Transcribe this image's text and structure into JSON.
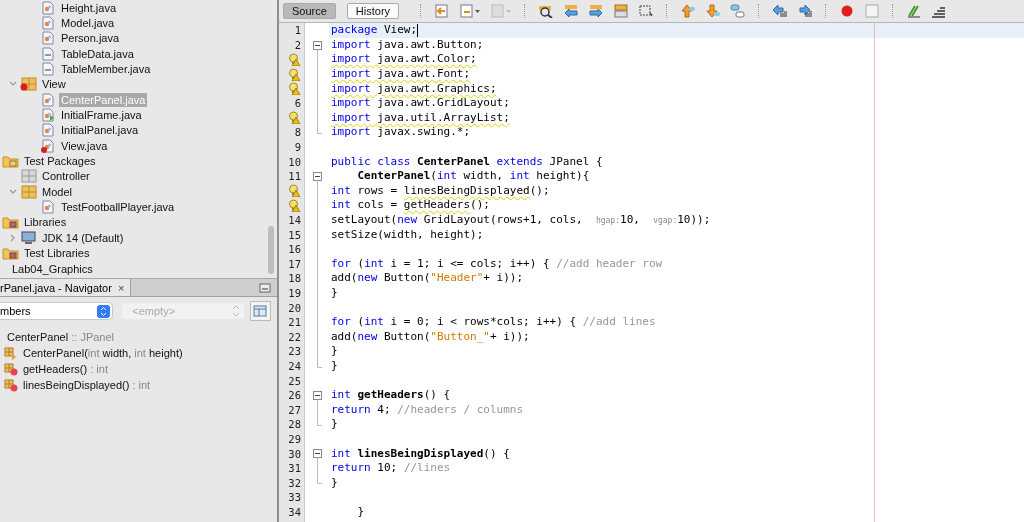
{
  "project_tree": [
    {
      "children": [
        {
          "children": [
            {
              "kind": "class",
              "label": "Height.java",
              "selected": false
            },
            {
              "kind": "class",
              "label": "Model.java",
              "selected": false
            },
            {
              "kind": "class",
              "label": "Person.java",
              "selected": false
            },
            {
              "kind": "interface",
              "label": "TableData.java",
              "selected": false
            },
            {
              "kind": "interface",
              "label": "TableMember.java",
              "selected": false
            }
          ]
        },
        {
          "kind": "package_error",
          "label": "View",
          "expanded": true,
          "selected": false,
          "children": [
            {
              "kind": "class",
              "label": "CenterPanel.java",
              "selected": true
            },
            {
              "kind": "main_class",
              "label": "InitialFrame.java",
              "selected": false
            },
            {
              "kind": "class",
              "label": "InitialPanel.java",
              "selected": false
            },
            {
              "kind": "class_error",
              "label": "View.java",
              "selected": false
            }
          ]
        }
      ]
    },
    {
      "kind": "test_folder",
      "label": "Test Packages",
      "selected": false,
      "children": [
        {
          "kind": "package_empty",
          "label": "Controller",
          "selected": false
        },
        {
          "kind": "package",
          "label": "Model",
          "expanded": true,
          "selected": false,
          "children": [
            {
              "kind": "class",
              "label": "TestFootballPlayer.java",
              "selected": false
            }
          ]
        }
      ]
    },
    {
      "kind": "library_folder",
      "label": "Libraries",
      "selected": false,
      "children": [
        {
          "kind": "jdk",
          "label": "JDK 14 (Default)",
          "expanded": false,
          "selected": false
        }
      ]
    },
    {
      "kind": "library_folder",
      "label": "Test Libraries",
      "selected": false
    },
    {
      "kind": "project",
      "label": "Lab04_Graphics",
      "selected": false
    }
  ],
  "navigator": {
    "title": "rPanel.java - Navigator",
    "close": "×",
    "filter": "mbers",
    "secondary": "<empty>",
    "header": [
      {
        "text": "CenterPanel",
        "muted": false
      },
      {
        "text": " :: JPanel",
        "muted": true
      }
    ],
    "items": [
      {
        "kind": "constructor",
        "parts": [
          {
            "text": "CenterPanel(",
            "muted": false
          },
          {
            "text": "int",
            "muted": true
          },
          {
            "text": " width, ",
            "muted": false
          },
          {
            "text": "int",
            "muted": true
          },
          {
            "text": " height)",
            "muted": false
          }
        ]
      },
      {
        "kind": "method",
        "parts": [
          {
            "text": "getHeaders()",
            "muted": false
          },
          {
            "text": " : int",
            "muted": true
          }
        ]
      },
      {
        "kind": "method",
        "parts": [
          {
            "text": "linesBeingDisplayed()",
            "muted": false
          },
          {
            "text": " : int",
            "muted": true
          }
        ]
      }
    ]
  },
  "editor_tabs": [
    {
      "label": "Source",
      "selected": true
    },
    {
      "label": "History",
      "selected": false
    }
  ],
  "code": [
    {
      "number": "1",
      "warning": false,
      "kind": "plain",
      "current": true,
      "caret": true,
      "tokens": [
        {
          "kind": "keyword",
          "text": "package"
        },
        {
          "kind": "plain",
          "text": " View;"
        }
      ]
    },
    {
      "number": "2",
      "warning": false,
      "kind": "fold_start",
      "tokens": [
        {
          "kind": "keyword",
          "text": "import"
        },
        {
          "kind": "plain",
          "text": " java.awt.Button;"
        }
      ]
    },
    {
      "warning": true,
      "kind": "fold_body",
      "tokens": [
        {
          "kind": "keyword",
          "text": "import",
          "flagged": true
        },
        {
          "kind": "plain",
          "text": " java.awt.Color;",
          "flagged": true
        }
      ]
    },
    {
      "warning": true,
      "kind": "fold_body",
      "tokens": [
        {
          "kind": "keyword",
          "text": "import",
          "flagged": true
        },
        {
          "kind": "plain",
          "text": " java.awt.Font;",
          "flagged": true
        }
      ]
    },
    {
      "warning": true,
      "kind": "fold_body",
      "tokens": [
        {
          "kind": "keyword",
          "text": "import",
          "flagged": true
        },
        {
          "kind": "plain",
          "text": " java.awt.Graphics;",
          "flagged": true
        }
      ]
    },
    {
      "number": "6",
      "warning": false,
      "kind": "fold_body",
      "tokens": [
        {
          "kind": "keyword",
          "text": "import"
        },
        {
          "kind": "plain",
          "text": " java.awt.GridLayout;"
        }
      ]
    },
    {
      "warning": true,
      "kind": "fold_body",
      "tokens": [
        {
          "kind": "keyword",
          "text": "import",
          "flagged": true
        },
        {
          "kind": "plain",
          "text": " java.util.ArrayList;",
          "flagged": true
        }
      ]
    },
    {
      "number": "8",
      "warning": false,
      "kind": "fold_end",
      "tokens": [
        {
          "kind": "keyword",
          "text": "import"
        },
        {
          "kind": "plain",
          "text": " javax.swing.*;"
        }
      ]
    },
    {
      "number": "9",
      "warning": false,
      "kind": "plain"
    },
    {
      "number": "10",
      "warning": false,
      "kind": "plain",
      "tokens": [
        {
          "kind": "keyword",
          "text": "public class"
        },
        {
          "kind": "name",
          "text": " CenterPanel"
        },
        {
          "kind": "keyword",
          "text": " extends"
        },
        {
          "kind": "plain",
          "text": " JPanel {"
        }
      ]
    },
    {
      "number": "11",
      "warning": false,
      "kind": "fold_start",
      "tokens": [
        {
          "kind": "name",
          "text": "    CenterPanel"
        },
        {
          "kind": "plain",
          "text": "("
        },
        {
          "kind": "keyword",
          "text": "int"
        },
        {
          "kind": "plain",
          "text": " width, "
        },
        {
          "kind": "keyword",
          "text": "int"
        },
        {
          "kind": "plain",
          "text": " height){"
        }
      ]
    },
    {
      "warning": true,
      "kind": "fold_body",
      "tokens": [
        {
          "kind": "keyword",
          "text": "int"
        },
        {
          "kind": "plain",
          "text": " rows = "
        },
        {
          "kind": "plain",
          "text": "linesBeingDisplayed",
          "flagged": true
        },
        {
          "kind": "plain",
          "text": "();"
        }
      ]
    },
    {
      "warning": true,
      "kind": "fold_body",
      "tokens": [
        {
          "kind": "keyword",
          "text": "int"
        },
        {
          "kind": "plain",
          "text": " cols = "
        },
        {
          "kind": "plain",
          "text": "getHeaders",
          "flagged": true
        },
        {
          "kind": "plain",
          "text": "();"
        }
      ]
    },
    {
      "number": "14",
      "warning": false,
      "kind": "fold_body",
      "tokens": [
        {
          "kind": "plain",
          "text": "setLayout("
        },
        {
          "kind": "keyword",
          "text": "new"
        },
        {
          "kind": "plain",
          "text": " GridLayout(rows+1, cols,  "
        },
        {
          "kind": "hint",
          "text": "hgap:"
        },
        {
          "kind": "plain",
          "text": "10,  "
        },
        {
          "kind": "hint",
          "text": "vgap:"
        },
        {
          "kind": "plain",
          "text": "10));"
        }
      ]
    },
    {
      "number": "15",
      "warning": false,
      "kind": "fold_body",
      "tokens": [
        {
          "kind": "plain",
          "text": "setSize(width, height);"
        }
      ]
    },
    {
      "number": "16",
      "warning": false,
      "kind": "fold_body"
    },
    {
      "number": "17",
      "warning": false,
      "kind": "fold_body",
      "tokens": [
        {
          "kind": "keyword",
          "text": "for"
        },
        {
          "kind": "plain",
          "text": " ("
        },
        {
          "kind": "keyword",
          "text": "int"
        },
        {
          "kind": "plain",
          "text": " i = 1; i <= cols; i++) { "
        },
        {
          "kind": "comment",
          "text": "//add header row"
        }
      ]
    },
    {
      "number": "18",
      "warning": false,
      "kind": "fold_body",
      "tokens": [
        {
          "kind": "plain",
          "text": "add("
        },
        {
          "kind": "keyword",
          "text": "new"
        },
        {
          "kind": "plain",
          "text": " Button("
        },
        {
          "kind": "string",
          "text": "\"Header\""
        },
        {
          "kind": "plain",
          "text": "+ i));"
        }
      ]
    },
    {
      "number": "19",
      "warning": false,
      "kind": "fold_body",
      "tokens": [
        {
          "kind": "plain",
          "text": "}"
        }
      ]
    },
    {
      "number": "20",
      "warning": false,
      "kind": "fold_body"
    },
    {
      "number": "21",
      "warning": false,
      "kind": "fold_body",
      "tokens": [
        {
          "kind": "keyword",
          "text": "for"
        },
        {
          "kind": "plain",
          "text": " ("
        },
        {
          "kind": "keyword",
          "text": "int"
        },
        {
          "kind": "plain",
          "text": " i = 0; i < rows*cols; i++) { "
        },
        {
          "kind": "comment",
          "text": "//add lines"
        }
      ]
    },
    {
      "number": "22",
      "warning": false,
      "kind": "fold_body",
      "tokens": [
        {
          "kind": "plain",
          "text": "add("
        },
        {
          "kind": "keyword",
          "text": "new"
        },
        {
          "kind": "plain",
          "text": " Button("
        },
        {
          "kind": "string",
          "text": "\"Button_\""
        },
        {
          "kind": "plain",
          "text": "+ i));"
        }
      ]
    },
    {
      "number": "23",
      "warning": false,
      "kind": "fold_body",
      "tokens": [
        {
          "kind": "plain",
          "text": "}"
        }
      ]
    },
    {
      "number": "24",
      "warning": false,
      "kind": "fold_end",
      "tokens": [
        {
          "kind": "plain",
          "text": "}"
        }
      ]
    },
    {
      "number": "25",
      "warning": false,
      "kind": "plain"
    },
    {
      "number": "26",
      "warning": false,
      "kind": "fold_start",
      "tokens": [
        {
          "kind": "keyword",
          "text": "int"
        },
        {
          "kind": "name",
          "text": " getHeaders"
        },
        {
          "kind": "plain",
          "text": "() {"
        }
      ]
    },
    {
      "number": "27",
      "warning": false,
      "kind": "fold_body",
      "tokens": [
        {
          "kind": "keyword",
          "text": "return"
        },
        {
          "kind": "plain",
          "text": " 4; "
        },
        {
          "kind": "comment",
          "text": "//headers / columns"
        }
      ]
    },
    {
      "number": "28",
      "warning": false,
      "kind": "fold_end",
      "tokens": [
        {
          "kind": "plain",
          "text": "}"
        }
      ]
    },
    {
      "number": "29",
      "warning": false,
      "kind": "plain"
    },
    {
      "number": "30",
      "warning": false,
      "kind": "fold_start",
      "tokens": [
        {
          "kind": "keyword",
          "text": "int"
        },
        {
          "kind": "name",
          "text": " linesBeingDisplayed"
        },
        {
          "kind": "plain",
          "text": "() {"
        }
      ]
    },
    {
      "number": "31",
      "warning": false,
      "kind": "fold_body",
      "tokens": [
        {
          "kind": "keyword",
          "text": "return"
        },
        {
          "kind": "plain",
          "text": " 10; "
        },
        {
          "kind": "comment",
          "text": "//lines"
        }
      ]
    },
    {
      "number": "32",
      "warning": false,
      "kind": "fold_end",
      "tokens": [
        {
          "kind": "plain",
          "text": "}"
        }
      ]
    },
    {
      "number": "33",
      "warning": false,
      "kind": "plain"
    },
    {
      "number": "34",
      "warning": false,
      "kind": "plain",
      "tokens": [
        {
          "kind": "plain",
          "text": "    }"
        }
      ]
    }
  ]
}
